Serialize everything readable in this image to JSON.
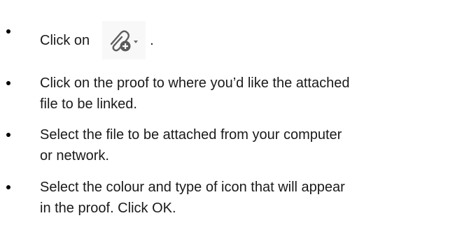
{
  "instructions": {
    "steps": [
      {
        "before": "Click on",
        "icon": "attach-file-add-dropdown-icon",
        "after": "."
      },
      {
        "lines": [
          "Click on the proof to where you’d like the attached",
          "file to be linked."
        ]
      },
      {
        "lines": [
          "Select the file to be attached from your computer",
          "or network."
        ]
      },
      {
        "lines": [
          "Select the colour and type of icon that will appear",
          "in the proof. Click OK."
        ]
      }
    ]
  }
}
